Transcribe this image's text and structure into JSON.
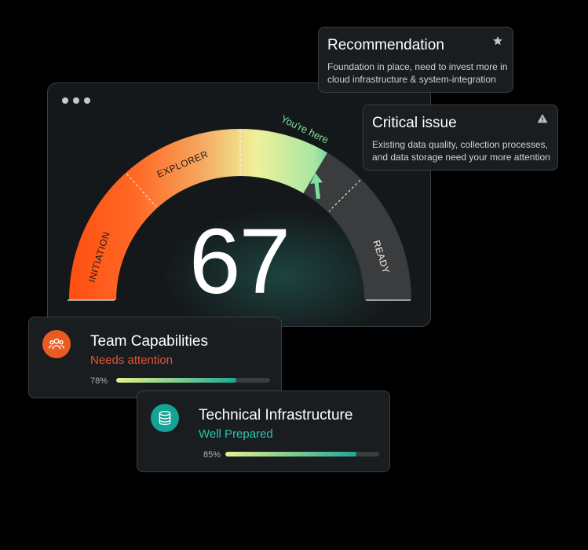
{
  "gauge": {
    "score": "67",
    "position_pct": 67,
    "segments": [
      "INITIATION",
      "EXPLORER",
      "READY"
    ],
    "marker_label": "You're here",
    "colors": {
      "initiation": "#ff5a1f",
      "explorer": "#f2a55a",
      "ready": "#3a3c3d",
      "accent": "#7fe0a0"
    }
  },
  "recommendation": {
    "title": "Recommendation",
    "text_line1": "Foundation in place, need to invest more in",
    "text_line2": "cloud infrastructure & system-integration",
    "icon": "star-icon"
  },
  "critical": {
    "title": "Critical issue",
    "text_line1": "Existing data quality, collection processes,",
    "text_line2": "and data storage need your more attention",
    "icon": "warning-icon"
  },
  "team": {
    "title": "Team Capabilities",
    "status": "Needs attention",
    "status_color": "#e0553a",
    "percent_label": "78%",
    "percent": 78,
    "icon": "team-icon",
    "icon_color": "#ea5a22"
  },
  "infra": {
    "title": "Technical Infrastructure",
    "status": "Well Prepared",
    "status_color": "#2fc3ae",
    "percent_label": "85%",
    "percent": 85,
    "icon": "database-icon",
    "icon_color": "#14a394"
  }
}
